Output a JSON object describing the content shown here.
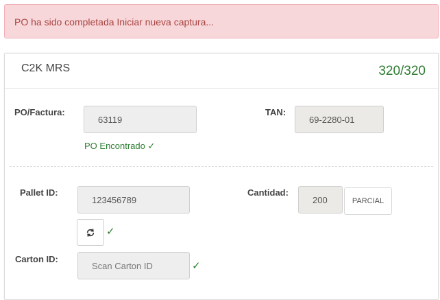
{
  "alert": {
    "message": "PO ha sido completada Iniciar nueva captura..."
  },
  "panel": {
    "title": "C2K MRS",
    "count": "320/320"
  },
  "po": {
    "label": "PO/Factura:",
    "value": "63119",
    "status": "PO Encontrado ✓"
  },
  "tan": {
    "label": "TAN:",
    "value": "69-2280-01"
  },
  "pallet": {
    "label": "Pallet ID:",
    "value": "123456789",
    "check": "✓"
  },
  "cantidad": {
    "label": "Cantidad:",
    "value": "200",
    "button": "PARCIAL"
  },
  "carton": {
    "label": "Carton ID:",
    "placeholder": "Scan Carton ID",
    "check": "✓"
  },
  "colors": {
    "success": "#2e7d32",
    "alert_bg": "#f8d7da",
    "alert_text": "#a94442"
  },
  "icons": {
    "refresh": "refresh-icon",
    "check": "check-icon"
  }
}
